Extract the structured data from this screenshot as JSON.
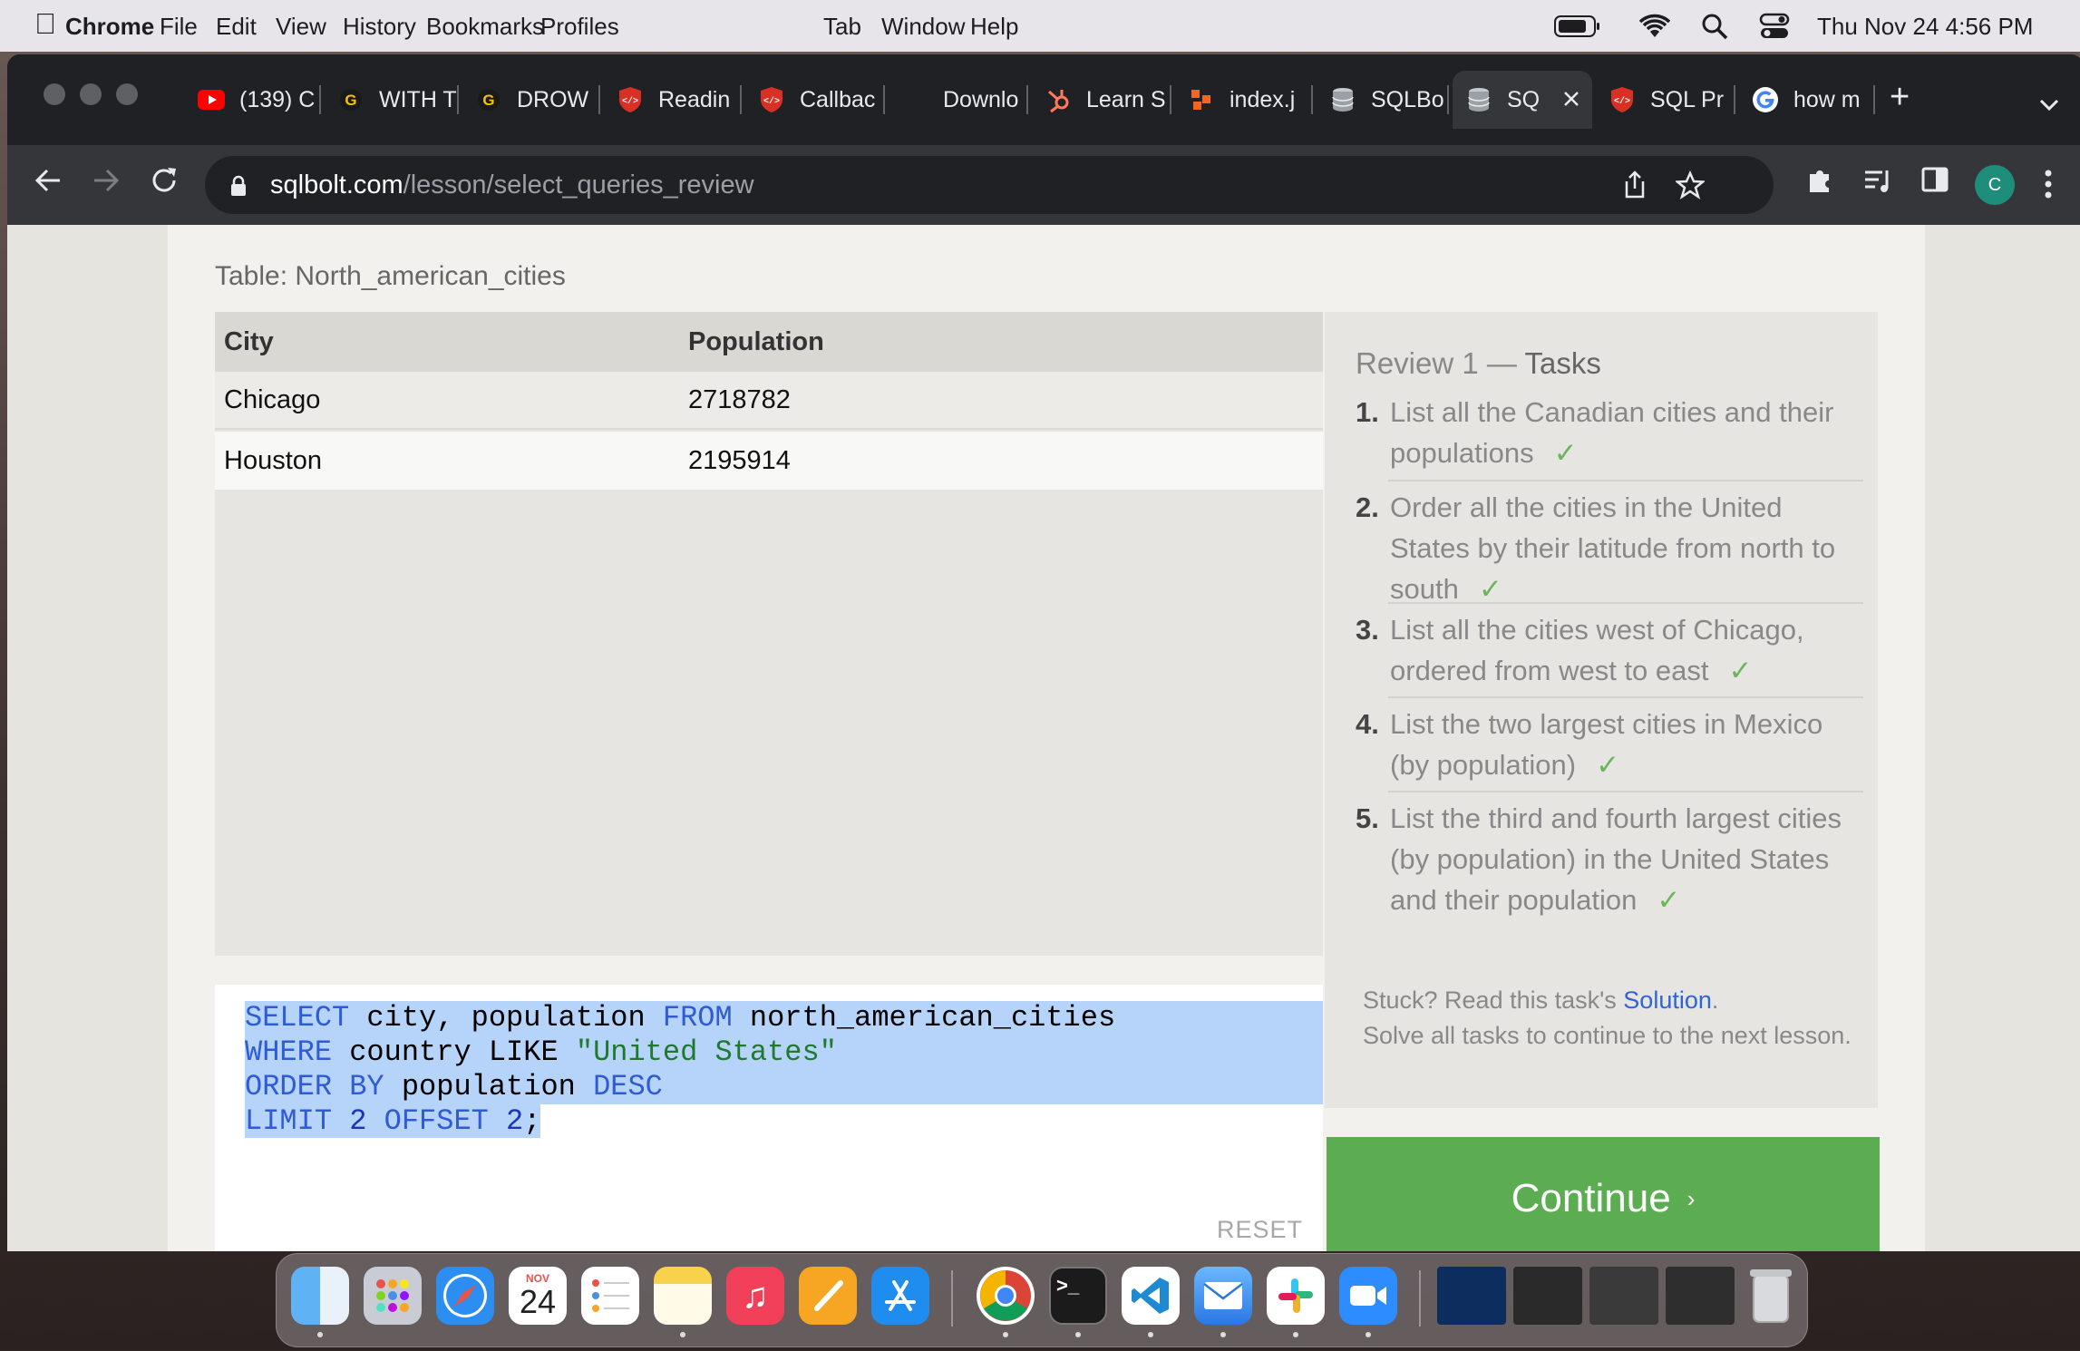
{
  "menubar": {
    "apple_icon": "apple-icon",
    "app_name": "Chrome",
    "menus": [
      "File",
      "Edit",
      "View",
      "History",
      "Bookmarks",
      "Profiles",
      "Tab",
      "Window",
      "Help"
    ],
    "clock": "Thu Nov 24  4:56 PM"
  },
  "browser": {
    "tabs": [
      {
        "label": "(139) C",
        "icon": "youtube-icon",
        "color": "#ff0000"
      },
      {
        "label": "WITH T",
        "icon": "grammarly-g-icon",
        "color": "#1a1a1a"
      },
      {
        "label": "DROW",
        "icon": "grammarly-g-icon",
        "color": "#1a1a1a"
      },
      {
        "label": "Readin",
        "icon": "shield-code-icon",
        "color": "#d93025"
      },
      {
        "label": "Callbac",
        "icon": "shield-code-icon",
        "color": "#d93025"
      },
      {
        "label": "Downlo",
        "icon": "download-page-icon",
        "color": "#202124"
      },
      {
        "label": "Learn S",
        "icon": "hubspot-icon",
        "color": "#ff7a59"
      },
      {
        "label": "index.j",
        "icon": "codepen-squares-icon",
        "color": "#f26522"
      },
      {
        "label": "SQLBo",
        "icon": "database-icon",
        "color": "#9aa0a6"
      },
      {
        "label": "SQ",
        "icon": "database-icon",
        "color": "#9aa0a6",
        "active": true
      },
      {
        "label": "SQL Pr",
        "icon": "shield-code-icon",
        "color": "#d93025"
      },
      {
        "label": "how m",
        "icon": "google-icon",
        "color": "#4285f4"
      }
    ],
    "new_tab": "+",
    "url_host": "sqlbolt.com",
    "url_path": "/lesson/select_queries_review",
    "profile_initial": "C"
  },
  "page": {
    "table_title": "Table: North_american_cities",
    "columns": [
      "City",
      "Population"
    ],
    "rows": [
      [
        "Chicago",
        "2718782"
      ],
      [
        "Houston",
        "2195914"
      ]
    ],
    "query_lines": [
      [
        {
          "t": "SELECT",
          "k": "kw"
        },
        {
          "t": " city, population ",
          "k": ""
        },
        {
          "t": "FROM",
          "k": "kw"
        },
        {
          "t": " north_american_cities",
          "k": ""
        }
      ],
      [
        {
          "t": "WHERE",
          "k": "kw"
        },
        {
          "t": " country LIKE ",
          "k": ""
        },
        {
          "t": "\"United States\"",
          "k": "str"
        }
      ],
      [
        {
          "t": "ORDER BY",
          "k": "kw"
        },
        {
          "t": " population ",
          "k": ""
        },
        {
          "t": "DESC",
          "k": "kw"
        }
      ],
      [
        {
          "t": "LIMIT",
          "k": "kw"
        },
        {
          "t": " ",
          "k": ""
        },
        {
          "t": "2",
          "k": "num"
        },
        {
          "t": " ",
          "k": ""
        },
        {
          "t": "OFFSET",
          "k": "kw"
        },
        {
          "t": " ",
          "k": ""
        },
        {
          "t": "2",
          "k": "num"
        },
        {
          "t": ";",
          "k": ""
        }
      ]
    ],
    "reset_label": "RESET",
    "tasks_title_prefix": "Review 1 — ",
    "tasks_title_suffix": "Tasks",
    "tasks": [
      {
        "num": "1.",
        "text": "List all the Canadian cities and their populations",
        "done": "✓"
      },
      {
        "num": "2.",
        "text": "Order all the cities in the United States by their latitude from north to south",
        "done": "✓"
      },
      {
        "num": "3.",
        "text": "List all the cities west of Chicago, ordered from west to east",
        "done": "✓"
      },
      {
        "num": "4.",
        "text": "List the two largest cities in Mexico (by population)",
        "done": "✓"
      },
      {
        "num": "5.",
        "text": "List the third and fourth largest cities (by population) in the United States and their population",
        "done": "✓"
      }
    ],
    "stuck_prefix": "Stuck? Read this task's ",
    "stuck_link": "Solution",
    "stuck_suffix": ".",
    "solve_text": "Solve all tasks to continue to the next lesson.",
    "continue_label": "Continue",
    "continue_arrow": "›"
  },
  "dock": {
    "calendar_month": "NOV",
    "calendar_day": "24",
    "apps": [
      "finder-icon",
      "launchpad-icon",
      "safari-icon",
      "calendar-icon",
      "reminders-icon",
      "notes-icon",
      "music-icon",
      "pages-icon",
      "app-store-icon",
      "chrome-icon",
      "terminal-icon",
      "vscode-icon",
      "mail-icon",
      "slack-icon",
      "zoom-icon"
    ]
  }
}
